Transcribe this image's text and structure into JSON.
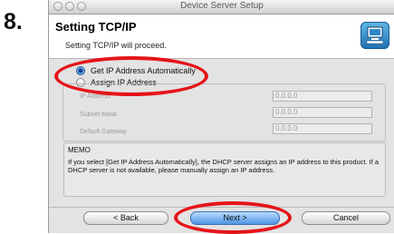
{
  "step_number": "8.",
  "window": {
    "title": "Device Server Setup"
  },
  "header": {
    "title": "Setting TCP/IP",
    "subtitle": "Setting TCP/IP will proceed."
  },
  "options": [
    {
      "label": "Get IP Address Automatically",
      "selected": true
    },
    {
      "label": "Assign IP Address",
      "selected": false
    }
  ],
  "fields": [
    {
      "label": "IP Address",
      "value": "0.0.0.0"
    },
    {
      "label": "Subnet Mask",
      "value": "0.0.0.0"
    },
    {
      "label": "Default Gateway",
      "value": "0.0.0.0"
    }
  ],
  "memo": {
    "title": "MEMO",
    "text": "If you select [Get IP Address Automatically], the DHCP server assigns an IP address to this product. If a DHCP server is not available, please manually assign an IP address."
  },
  "buttons": {
    "back": "< Back",
    "next": "Next >",
    "cancel": "Cancel"
  },
  "colors": {
    "highlight": "#e5141a",
    "accent": "#4f95e3"
  }
}
